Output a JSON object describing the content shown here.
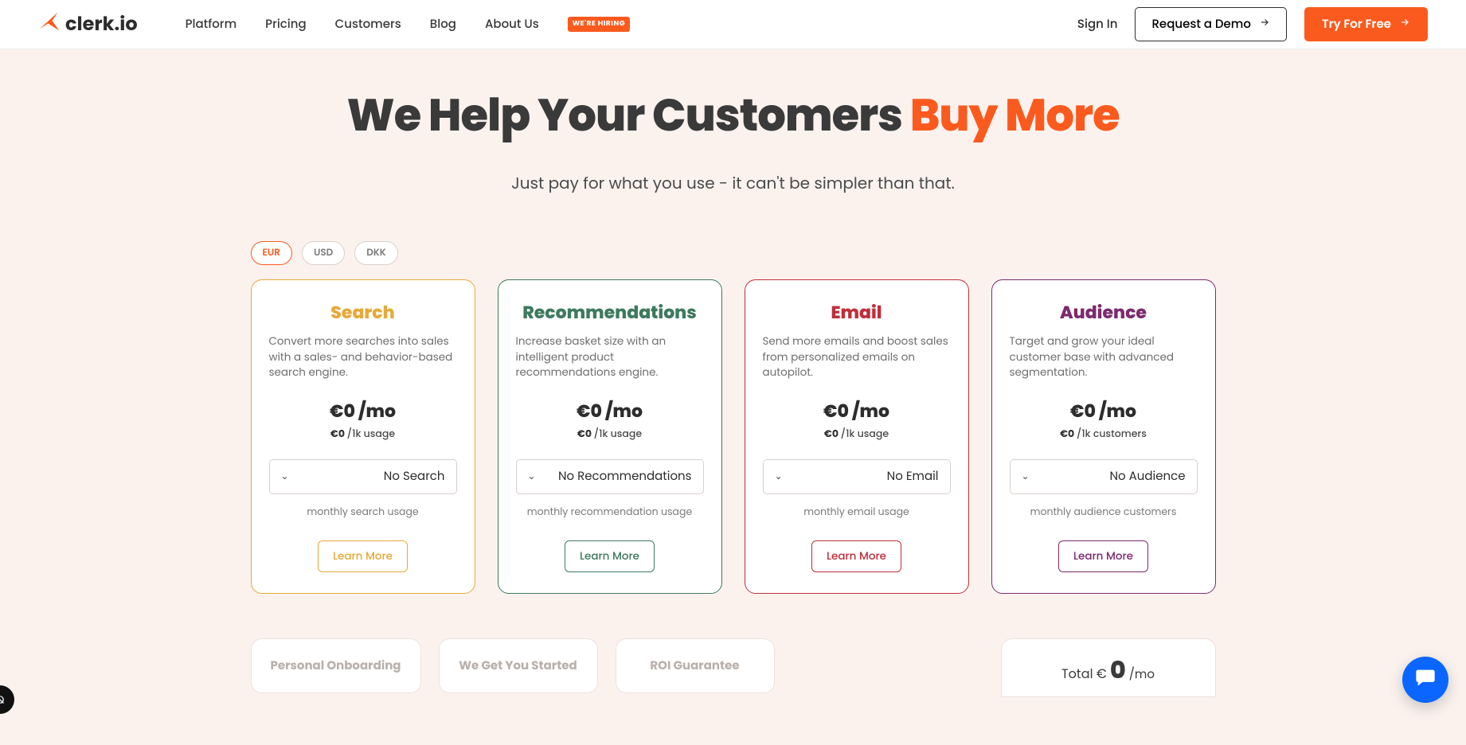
{
  "header": {
    "brand": "clerk.io",
    "nav": {
      "platform": "Platform",
      "pricing": "Pricing",
      "customers": "Customers",
      "blog": "Blog",
      "about": "About Us",
      "hiring_badge": "WE'RE HIRING"
    },
    "signin": "Sign In",
    "demo": "Request a Demo",
    "try": "Try For Free"
  },
  "hero": {
    "title_a": "We Help Your Customers ",
    "title_b": "Buy More",
    "subtitle": "Just pay for what you use - it can't be simpler than that."
  },
  "currencies": {
    "eur": "EUR",
    "usd": "USD",
    "dkk": "DKK"
  },
  "cards": {
    "search": {
      "title": "Search",
      "desc": "Convert more searches into sales with a sales- and behavior-based search engine.",
      "price": "€0 /mo",
      "subprice_val": "€0 ",
      "subprice_unit": "/1k usage",
      "selector": "No Search",
      "caption": "monthly search usage",
      "learn": "Learn More"
    },
    "reco": {
      "title": "Recommendations",
      "desc": "Increase basket size with an intelligent product recommendations engine.",
      "price": "€0 /mo",
      "subprice_val": "€0 ",
      "subprice_unit": "/1k usage",
      "selector": "No Recommendations",
      "caption": "monthly recommendation usage",
      "learn": "Learn More"
    },
    "email": {
      "title": "Email",
      "desc": "Send more emails and boost sales from personalized emails on autopilot.",
      "price": "€0 /mo",
      "subprice_val": "€0 ",
      "subprice_unit": "/1k usage",
      "selector": "No Email",
      "caption": "monthly email usage",
      "learn": "Learn More"
    },
    "aud": {
      "title": "Audience",
      "desc": "Target and grow your ideal customer base with advanced segmentation.",
      "price": "€0 /mo",
      "subprice_val": "€0 ",
      "subprice_unit": "/1k customers",
      "selector": "No Audience",
      "caption": "monthly audience customers",
      "learn": "Learn More"
    }
  },
  "bottom": {
    "onboarding": "Personal Onboarding",
    "started": "We Get You Started",
    "roi": "ROI Guarantee",
    "total_prefix": "Total € ",
    "total_value": "0",
    "total_suffix": " /mo"
  }
}
